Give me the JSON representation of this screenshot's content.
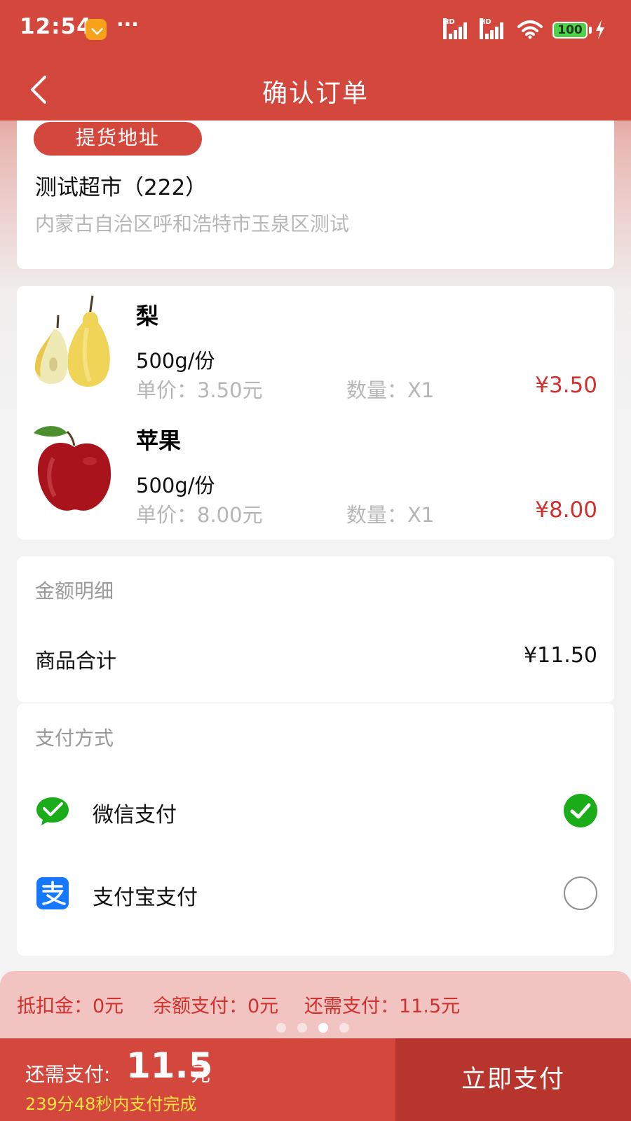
{
  "status_bar": {
    "time": "12:54",
    "menu_dots": "···",
    "battery_level": "100"
  },
  "header": {
    "title": "确认订单"
  },
  "address": {
    "badge": "提货地址",
    "store_name": "测试超市（222）",
    "store_address": "内蒙古自治区呼和浩特市玉泉区测试"
  },
  "products": [
    {
      "name": "梨",
      "spec": "500g/份",
      "unit_price": "单价：3.50元",
      "quantity": "数量：X1",
      "price": "¥3.50",
      "image_icon": "pear-icon"
    },
    {
      "name": "苹果",
      "spec": "500g/份",
      "unit_price": "单价：8.00元",
      "quantity": "数量：X1",
      "price": "¥8.00",
      "image_icon": "apple-icon"
    }
  ],
  "amount": {
    "title": "金额明细",
    "subtotal_label": "商品合计",
    "subtotal_value": "¥11.50"
  },
  "payment": {
    "title": "支付方式",
    "options": [
      {
        "label": "微信支付",
        "icon": "wechat-pay-icon",
        "selected": true
      },
      {
        "label": "支付宝支付",
        "icon": "alipay-icon",
        "selected": false
      }
    ]
  },
  "deduction": {
    "deduction_amount": "抵扣金：0元",
    "balance_payment": "余额支付：0元",
    "remaining_payment": "还需支付：11.5元"
  },
  "bottom": {
    "due_label": "还需支付:",
    "due_amount": "11.5",
    "due_unit": "元",
    "countdown": "239分48秒内支付完成",
    "pay_button": "立即支付"
  },
  "colors": {
    "primary": "#d4473d",
    "price_red": "#d0312d",
    "countdown_yellow": "#ffe23d",
    "wechat_green": "#1aad19",
    "alipay_blue": "#1677ff"
  }
}
